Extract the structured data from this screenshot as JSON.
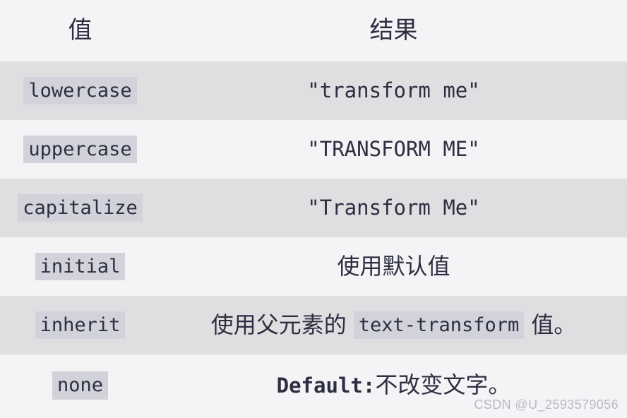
{
  "table": {
    "headers": {
      "value": "值",
      "result": "结果"
    },
    "rows": [
      {
        "value": "lowercase",
        "result_text": "\"transform me\"",
        "result_kind": "mono"
      },
      {
        "value": "uppercase",
        "result_text": "\"TRANSFORM ME\"",
        "result_kind": "mono"
      },
      {
        "value": "capitalize",
        "result_text": "\"Transform Me\"",
        "result_kind": "mono"
      },
      {
        "value": "initial",
        "result_text": "使用默认值",
        "result_kind": "cjk"
      },
      {
        "value": "inherit",
        "result_kind": "cjk-with-code",
        "result_prefix": "使用父元素的",
        "result_code": "text-transform",
        "result_suffix": "值。"
      },
      {
        "value": "none",
        "result_kind": "bold-label-cjk",
        "result_label": "Default:",
        "result_text": "不改变文字。"
      }
    ]
  },
  "watermark": "CSDN @U_2593579056",
  "colors": {
    "text": "#2e2e42",
    "row_odd_bg": "#dfdfe1",
    "row_even_bg": "#f4f4f6",
    "chip_bg": "#d2d2da",
    "watermark": "#b9b9c2"
  }
}
